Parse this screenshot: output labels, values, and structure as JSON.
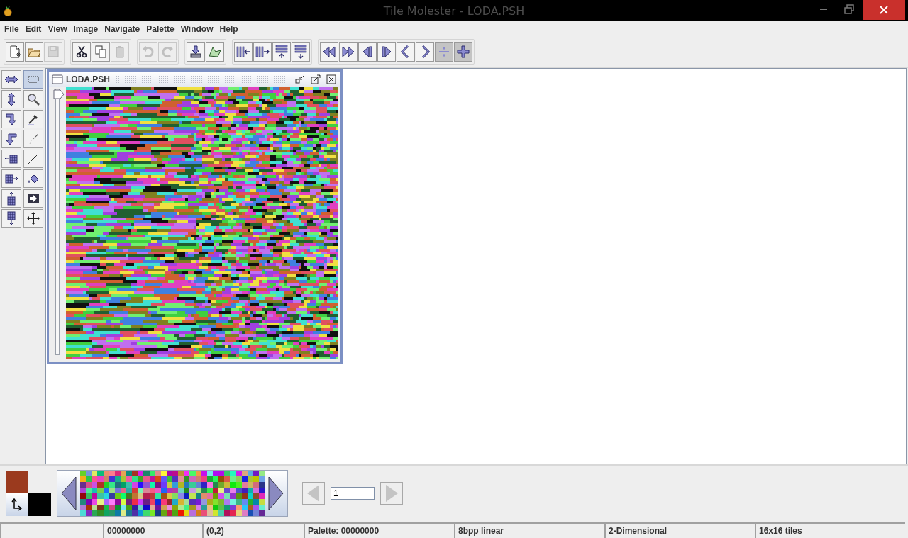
{
  "window": {
    "title": "Tile Molester - LODA.PSH"
  },
  "menu": [
    "File",
    "Edit",
    "View",
    "Image",
    "Navigate",
    "Palette",
    "Window",
    "Help"
  ],
  "toolbar": {
    "groups": [
      {
        "buttons": [
          {
            "disabled": false,
            "pressed": false
          },
          {
            "disabled": false,
            "pressed": false
          },
          {
            "disabled": true,
            "pressed": false
          }
        ]
      },
      {
        "buttons": [
          {
            "disabled": false,
            "pressed": false
          },
          {
            "disabled": false,
            "pressed": false
          },
          {
            "disabled": true,
            "pressed": false
          }
        ]
      },
      {
        "buttons": [
          {
            "disabled": true,
            "pressed": false
          },
          {
            "disabled": true,
            "pressed": false
          }
        ]
      },
      {
        "buttons": [
          {
            "disabled": false,
            "pressed": false
          },
          {
            "disabled": false,
            "pressed": false
          }
        ]
      },
      {
        "buttons": [
          {
            "disabled": false,
            "pressed": false
          },
          {
            "disabled": false,
            "pressed": false
          },
          {
            "disabled": false,
            "pressed": false
          },
          {
            "disabled": false,
            "pressed": false
          }
        ]
      },
      {
        "buttons": [
          {
            "disabled": false,
            "pressed": false
          },
          {
            "disabled": false,
            "pressed": false
          },
          {
            "disabled": false,
            "pressed": false
          },
          {
            "disabled": false,
            "pressed": false
          },
          {
            "disabled": false,
            "pressed": false
          },
          {
            "disabled": false,
            "pressed": false
          },
          {
            "disabled": false,
            "pressed": true
          },
          {
            "disabled": false,
            "pressed": true
          }
        ]
      }
    ]
  },
  "tools": [
    {
      "selected": false
    },
    {
      "selected": true
    },
    {
      "selected": false
    },
    {
      "selected": false
    },
    {
      "selected": false
    },
    {
      "selected": false
    },
    {
      "selected": false
    },
    {
      "selected": false
    },
    {
      "selected": false
    },
    {
      "selected": false
    },
    {
      "selected": false
    },
    {
      "selected": false
    },
    {
      "selected": false
    },
    {
      "selected": false
    },
    {
      "selected": false
    },
    {
      "selected": false
    }
  ],
  "document": {
    "title": "LODA.PSH",
    "slider": {
      "level": 0
    }
  },
  "page": {
    "value": "1",
    "previous_disabled": true,
    "next_disabled": true
  },
  "status_bar": [
    "00000000",
    "(0,2)",
    "Palette: 00000000",
    "8bpp linear",
    "2-Dimensional",
    "16x16 tiles"
  ]
}
